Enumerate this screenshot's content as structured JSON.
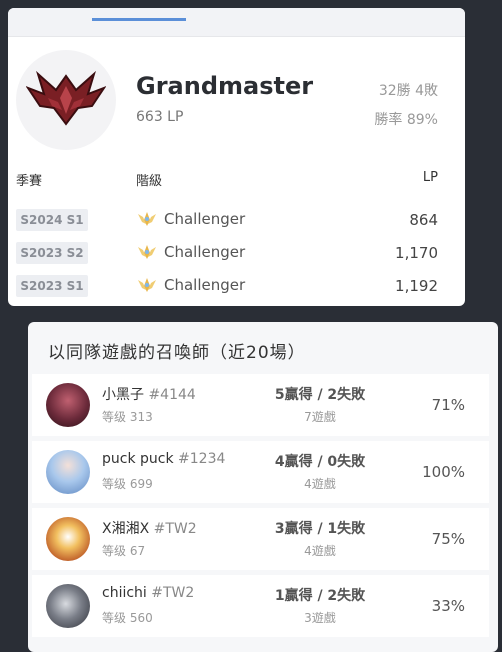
{
  "rank": {
    "tier": "Grandmaster",
    "lp": "663 LP",
    "record": "32勝 4敗",
    "winrate": "勝率 89%"
  },
  "history": {
    "headers": {
      "season": "季賽",
      "tier": "階級",
      "lp": "LP"
    },
    "rows": [
      {
        "season": "S2024 S1",
        "tier": "Challenger",
        "lp": "864"
      },
      {
        "season": "S2023 S2",
        "tier": "Challenger",
        "lp": "1,170"
      },
      {
        "season": "S2023 S1",
        "tier": "Challenger",
        "lp": "1,192"
      }
    ]
  },
  "teammates": {
    "title": "以同隊遊戲的召喚師（近20場）",
    "rows": [
      {
        "name": "小黑子",
        "tag": "#4144",
        "level": "等级 313",
        "wl": "5贏得 / 2失敗",
        "games": "7遊戲",
        "pct": "71%",
        "avatar_color": "#6b2a3a"
      },
      {
        "name": "puck puck",
        "tag": "#1234",
        "level": "等级 699",
        "wl": "4贏得 / 0失敗",
        "games": "4遊戲",
        "pct": "100%",
        "avatar_color": "#8fb7e0"
      },
      {
        "name": "X湘湘X",
        "tag": "#TW2",
        "level": "等级 67",
        "wl": "3贏得 / 1失敗",
        "games": "4遊戲",
        "pct": "75%",
        "avatar_color": "#e0a040"
      },
      {
        "name": "chiichi",
        "tag": "#TW2",
        "level": "等级 560",
        "wl": "1贏得 / 2失敗",
        "games": "3遊戲",
        "pct": "33%",
        "avatar_color": "#4a4e58"
      }
    ]
  },
  "colors": {
    "accent": "#5b8fd8",
    "emblem": "#7a1f24",
    "challenger": "#e8b64a"
  }
}
